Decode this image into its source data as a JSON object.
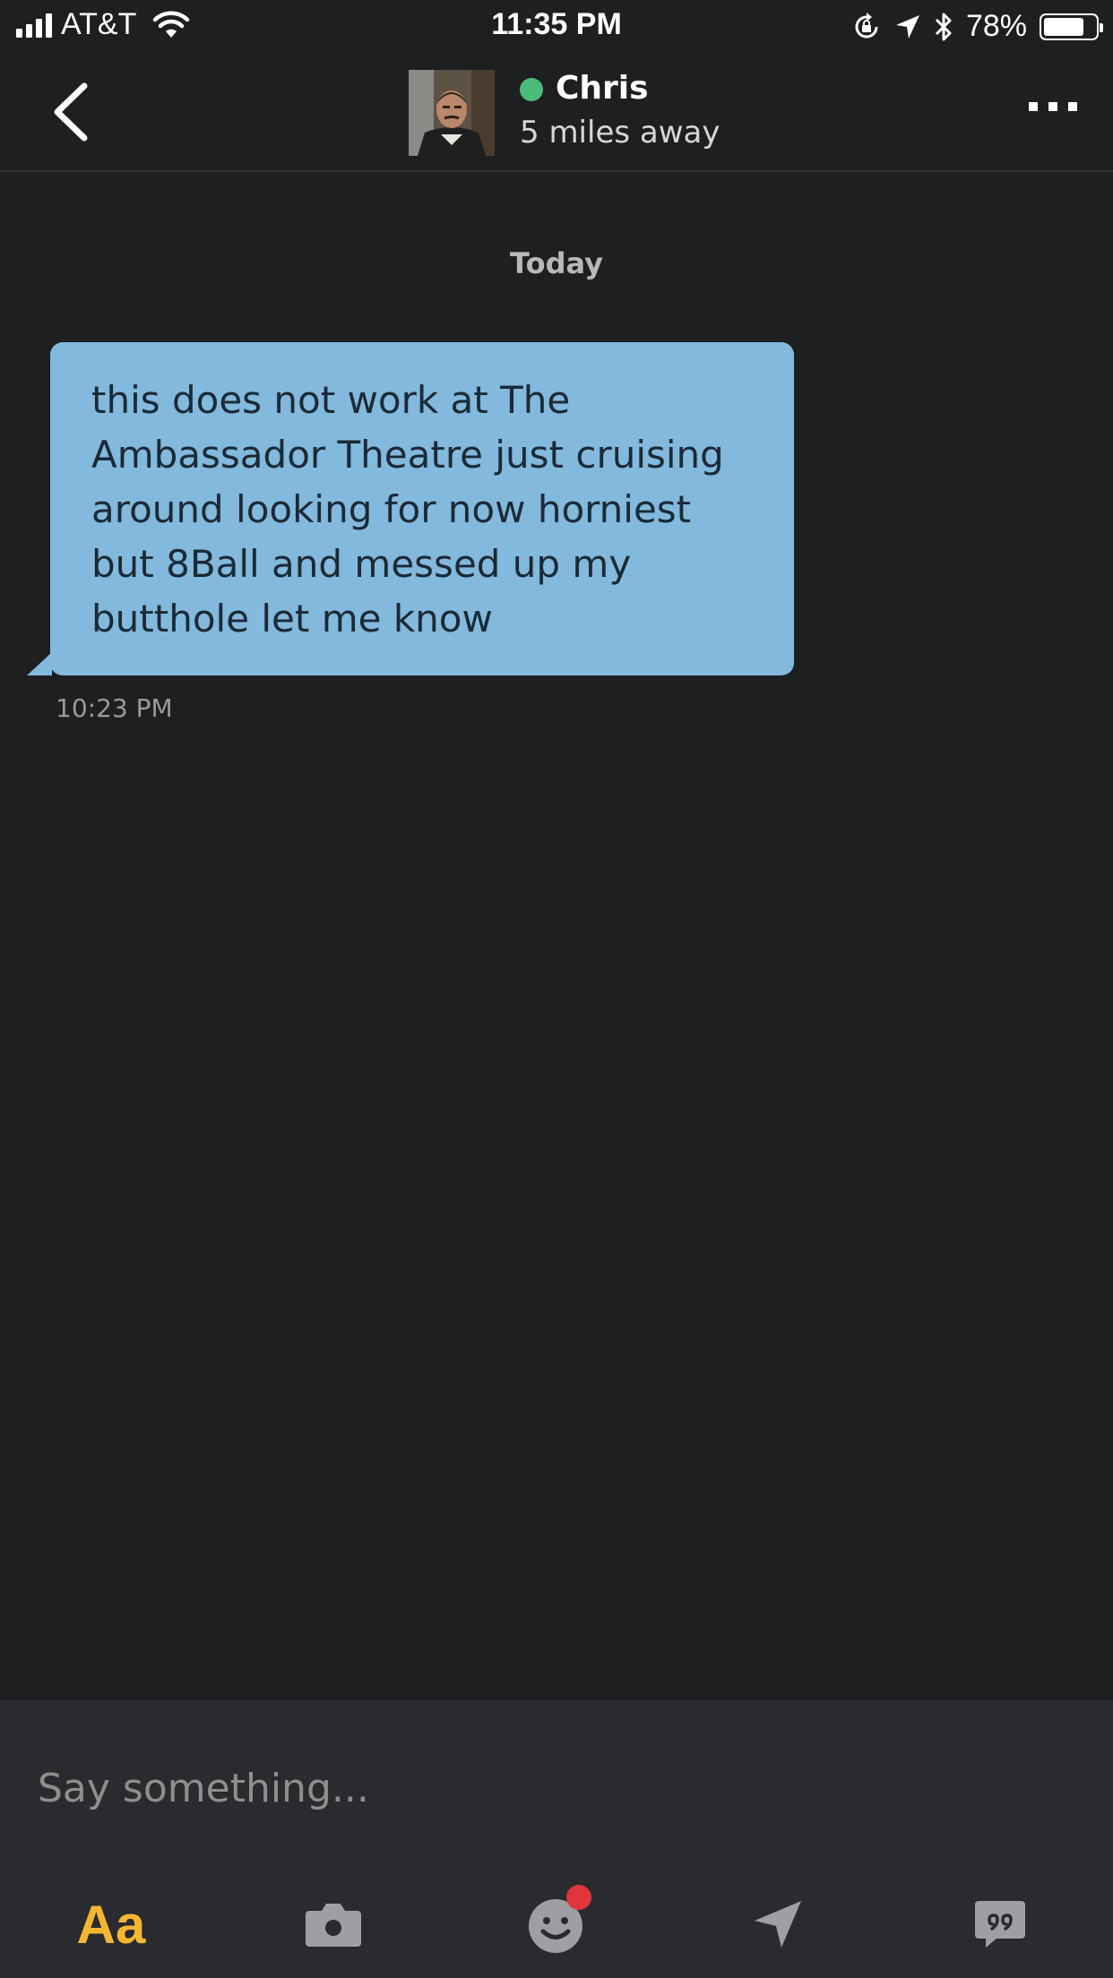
{
  "status_bar": {
    "carrier": "AT&T",
    "time": "11:35 PM",
    "battery_percent": "78%",
    "battery_level": 0.78
  },
  "header": {
    "back_icon": "chevron-left-icon",
    "contact_name": "Chris",
    "distance": "5 miles away",
    "online_color": "#4cbb7a",
    "more_icon": "more-dots-icon"
  },
  "chat": {
    "day_label": "Today",
    "messages": [
      {
        "text": "this does not work at The Ambassador Theatre just cruising around looking for now horniest but 8Ball and messed up my butthole let me know",
        "time": "10:23 PM",
        "bubble_color": "#82b9dc"
      }
    ]
  },
  "composer": {
    "placeholder": "Say something...",
    "text_format_label": "Aa",
    "accent_color": "#f4b731",
    "tools": [
      "text-format",
      "camera-icon",
      "emoji-icon",
      "location-send-icon",
      "saved-phrases-icon"
    ]
  }
}
